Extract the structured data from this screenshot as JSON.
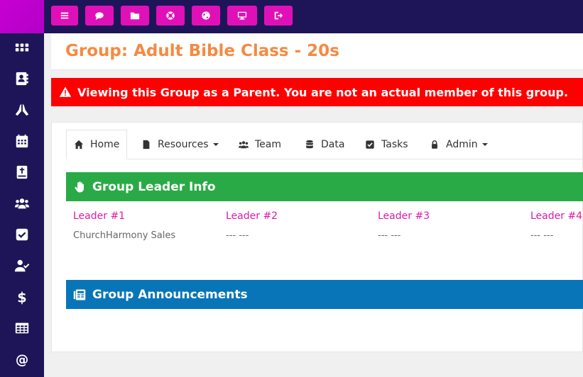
{
  "sidebar": {
    "items": [
      {
        "icon": "grid-icon"
      },
      {
        "icon": "address-book-icon"
      },
      {
        "icon": "praying-hands-icon"
      },
      {
        "icon": "calendar-icon"
      },
      {
        "icon": "bible-icon"
      },
      {
        "icon": "users-icon"
      },
      {
        "icon": "check-square-icon"
      },
      {
        "icon": "user-check-icon"
      },
      {
        "icon": "dollar-icon"
      },
      {
        "icon": "table-icon"
      },
      {
        "icon": "at-icon"
      }
    ],
    "brand_color": "#c800d2",
    "background": "#1e1558"
  },
  "toolbar": {
    "buttons": [
      {
        "icon": "menu-icon"
      },
      {
        "icon": "comment-icon"
      },
      {
        "icon": "folder-icon"
      },
      {
        "icon": "lifebuoy-icon"
      },
      {
        "icon": "globe-icon"
      },
      {
        "icon": "desktop-icon"
      },
      {
        "icon": "sign-out-icon"
      }
    ],
    "button_color": "#e010b8"
  },
  "page": {
    "title": "Group: Adult Bible Class - 20s",
    "title_color": "#f58a42"
  },
  "alert": {
    "icon": "warning-icon",
    "text": "Viewing this Group as a Parent. You are not an actual member of this group.",
    "color": "#ff0000"
  },
  "tabs": [
    {
      "label": "Home",
      "icon": "home-icon",
      "active": true
    },
    {
      "label": "Resources",
      "icon": "file-icon",
      "dropdown": true
    },
    {
      "label": "Team",
      "icon": "users-icon"
    },
    {
      "label": "Data",
      "icon": "database-icon"
    },
    {
      "label": "Tasks",
      "icon": "check-square-icon"
    },
    {
      "label": "Admin",
      "icon": "lock-icon",
      "dropdown": true
    }
  ],
  "leader_info": {
    "title": "Group Leader Info",
    "icon": "hand-icon",
    "color": "#2aaa46",
    "leaders": [
      {
        "label": "Leader #1",
        "value": "ChurchHarmony Sales"
      },
      {
        "label": "Leader #2",
        "value": "--- ---"
      },
      {
        "label": "Leader #3",
        "value": "--- ---"
      },
      {
        "label": "Leader #4",
        "value": "--- ---"
      }
    ]
  },
  "announcements": {
    "title": "Group Announcements",
    "icon": "newspaper-icon",
    "color": "#0875b8"
  }
}
